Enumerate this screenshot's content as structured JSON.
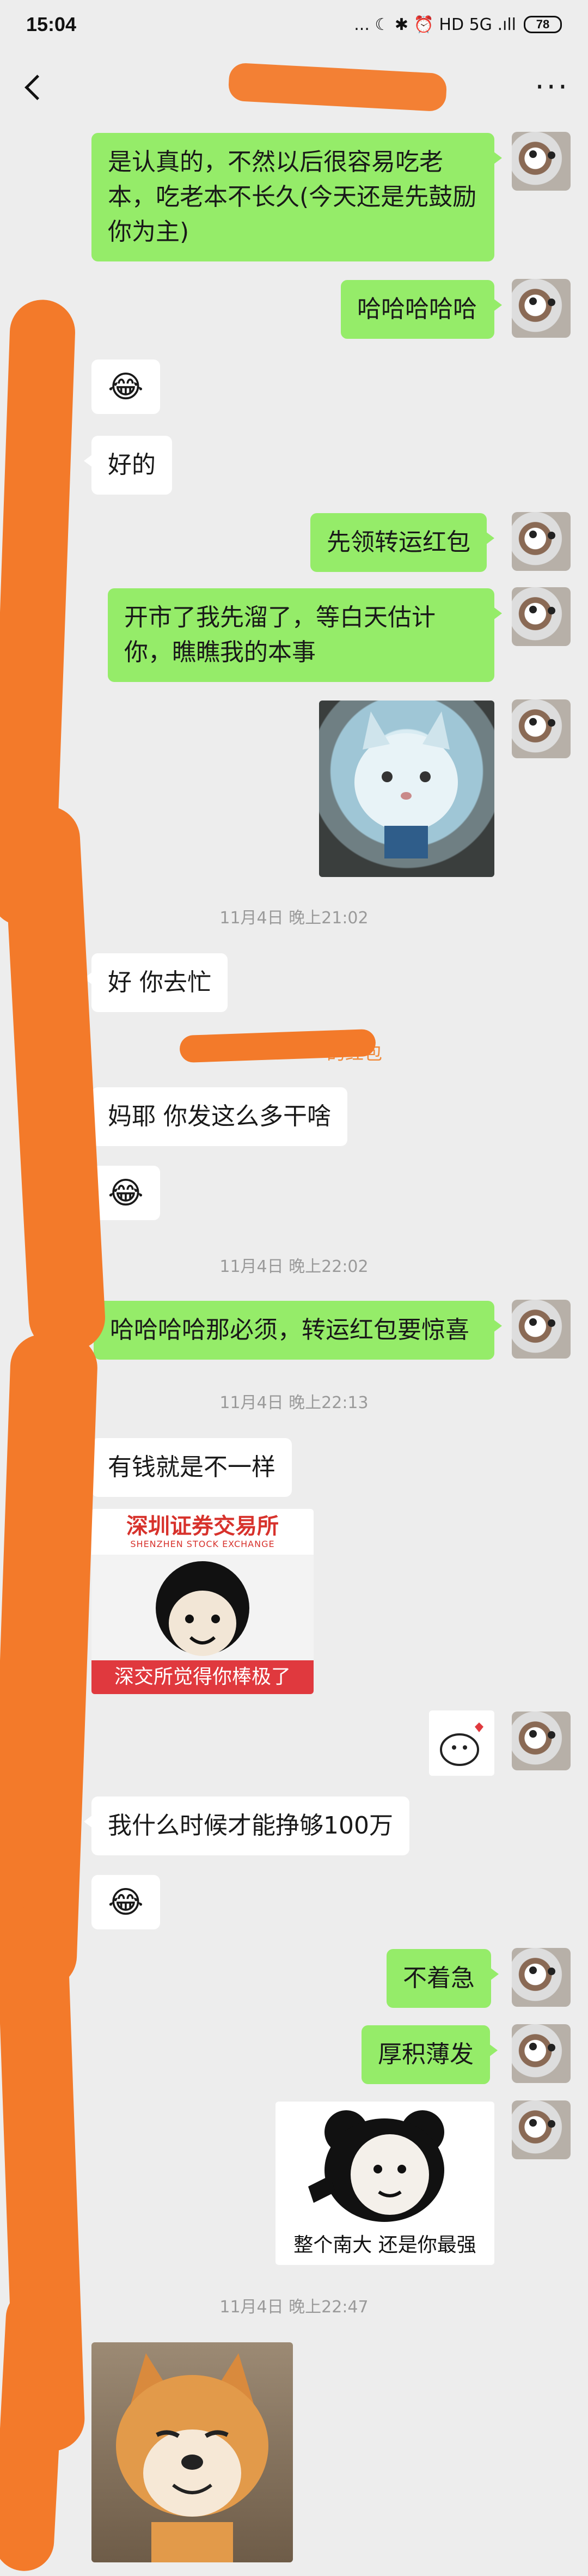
{
  "status_bar": {
    "time": "15:04",
    "icons": "... ☾ ✱ ⏰ HD 5G .ıll",
    "battery": "78"
  },
  "header": {
    "more_label": "···"
  },
  "messages": {
    "m1": "是认真的，不然以后很容易吃老本，吃老本不长久(今天还是先鼓励你为主)",
    "m2": "哈哈哈哈哈",
    "m3": "好的",
    "m4": "先领转运红包",
    "m5": "开市了我先溜了，等白天估计你，瞧瞧我的本事",
    "m6": "好 你去忙",
    "m7": "妈耶 你发这么多干啥",
    "m8": "哈哈哈哈那必须，转运红包要惊喜",
    "m9": "有钱就是不一样",
    "m10": "我什么时候才能挣够100万",
    "m11": "不着急",
    "m12": "厚积薄发"
  },
  "timestamps": {
    "t1": "11月4日 晚上21:02",
    "t2": "11月4日 晚上22:02",
    "t3": "11月4日 晚上22:13",
    "t4": "11月4日 晚上22:47"
  },
  "red_packet_notice": "的红包",
  "stickers": {
    "szse_title": "深圳证券交易所",
    "szse_subtitle": "SHENZHEN STOCK EXCHANGE",
    "szse_caption": "深交所觉得你棒极了",
    "panda_caption": "整个南大 还是你最强",
    "emoji": "😂"
  },
  "colors": {
    "me_bubble": "#95ec69",
    "them_bubble": "#ffffff",
    "background": "#ededed",
    "redaction": "#f37a2a",
    "szse_red": "#d7322c"
  }
}
